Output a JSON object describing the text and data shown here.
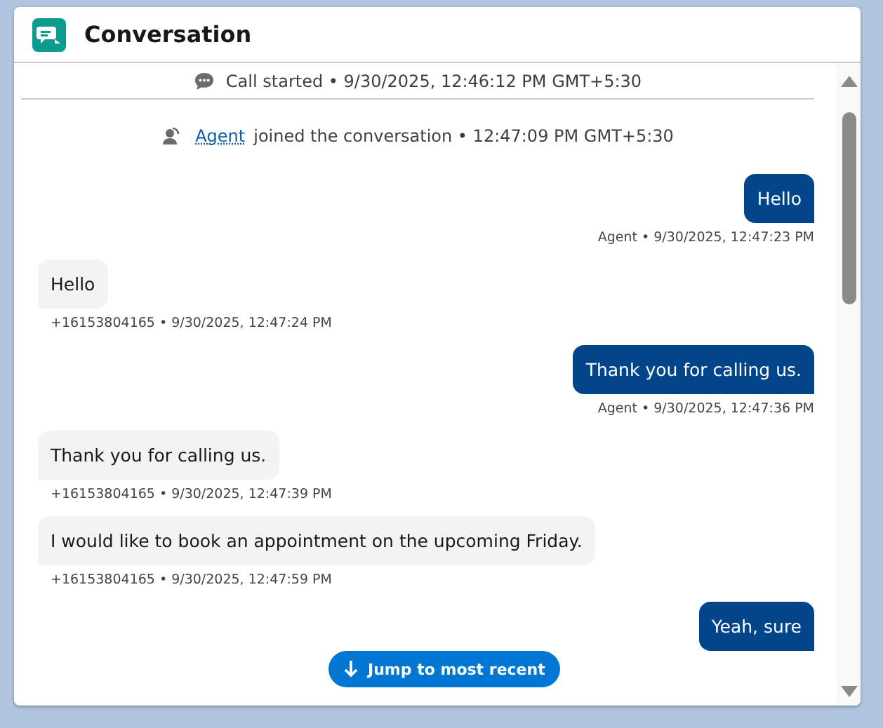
{
  "window": {
    "title": "Conversation"
  },
  "call_event": {
    "text": "Call started • 9/30/2025, 12:46:12 PM GMT+5:30"
  },
  "join_event": {
    "link": "Agent",
    "text": "joined the conversation • 12:47:09 PM GMT+5:30"
  },
  "messages": [
    {
      "kind": "agent",
      "text": "Hello",
      "meta": "Agent • 9/30/2025, 12:47:23 PM"
    },
    {
      "kind": "customer",
      "text": "Hello",
      "meta": "+16153804165 • 9/30/2025, 12:47:24 PM"
    },
    {
      "kind": "agent",
      "text": "Thank you for calling us.",
      "meta": "Agent • 9/30/2025, 12:47:36 PM"
    },
    {
      "kind": "customer",
      "text": "Thank you for calling us.",
      "meta": "+16153804165 • 9/30/2025, 12:47:39 PM"
    },
    {
      "kind": "customer",
      "text": "I would like to book an appointment on the upcoming Friday.",
      "meta": "+16153804165 • 9/30/2025, 12:47:59 PM"
    },
    {
      "kind": "agent",
      "text": "Yeah, sure"
    }
  ],
  "jump_button": {
    "label": "Jump to most recent"
  }
}
